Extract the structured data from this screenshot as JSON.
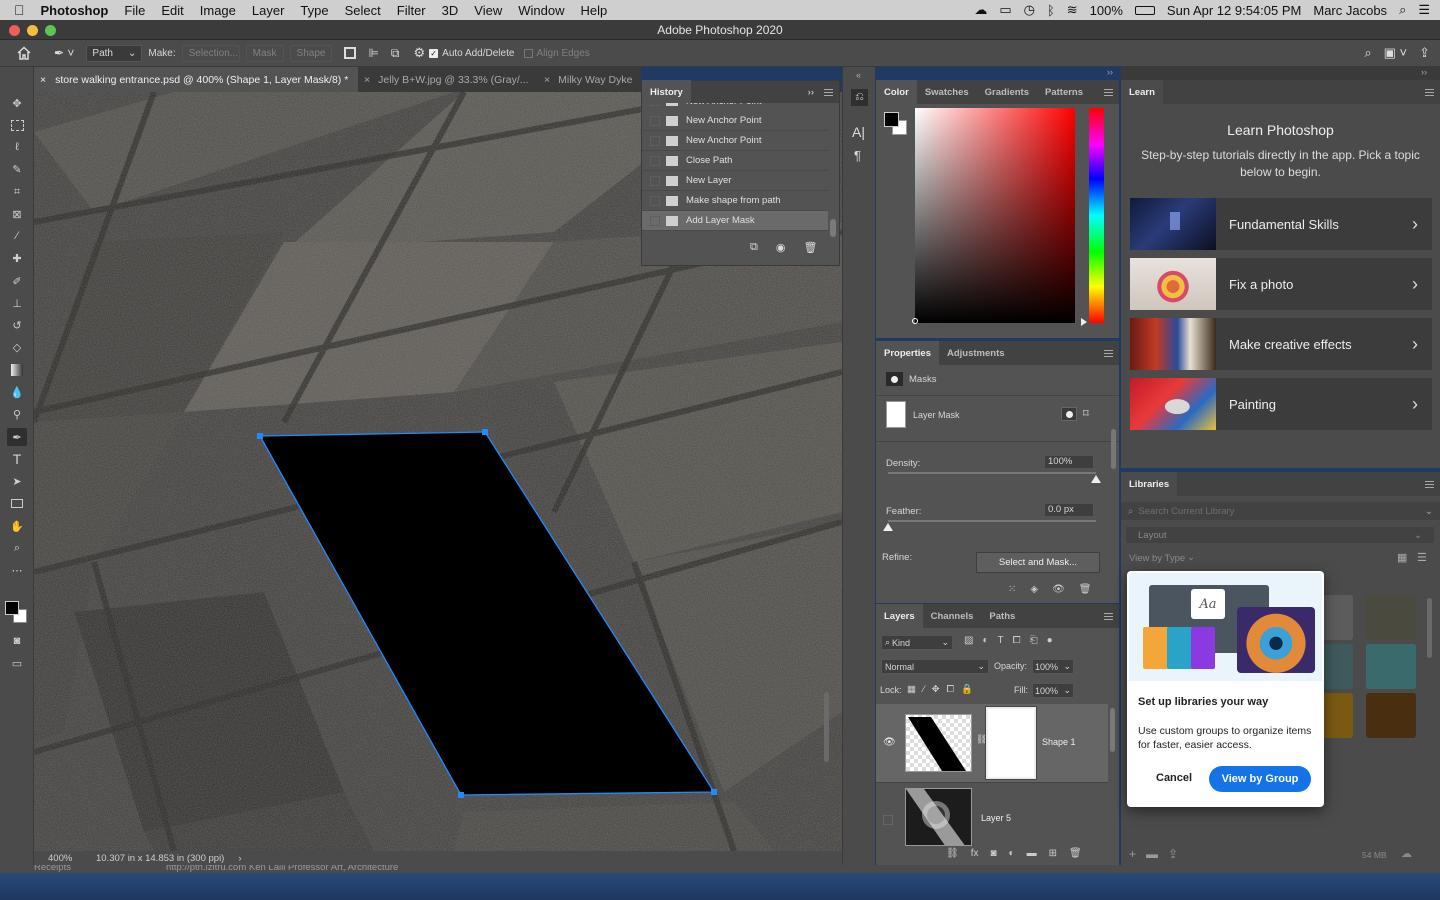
{
  "menubar": {
    "apple": "",
    "app": "Photoshop",
    "items": [
      "File",
      "Edit",
      "Image",
      "Layer",
      "Type",
      "Select",
      "Filter",
      "3D",
      "View",
      "Window",
      "Help"
    ],
    "battery": "100%",
    "datetime": "Sun Apr 12  9:54:05 PM",
    "user": "Marc Jacobs"
  },
  "titlebar": {
    "title": "Adobe Photoshop 2020"
  },
  "options": {
    "mode": "Path",
    "make_label": "Make:",
    "selection": "Selection...",
    "mask": "Mask",
    "shape": "Shape",
    "auto_add_delete": "Auto Add/Delete",
    "align_edges": "Align Edges"
  },
  "doctabs": [
    {
      "label": "store walking entrance.psd @ 400% (Shape 1, Layer Mask/8) *"
    },
    {
      "label": "Jelly B+W.jpg @ 33.3% (Gray/..."
    },
    {
      "label": "Milky Way Dyke"
    }
  ],
  "status": {
    "zoom": "400%",
    "size": "10.307 in x 14.853 in (300 ppi)"
  },
  "history": {
    "title": "History",
    "items": [
      "New Anchor Point",
      "New Anchor Point",
      "New Anchor Point",
      "Close Path",
      "New Layer",
      "Make shape from path",
      "Add Layer Mask"
    ]
  },
  "color_panel": {
    "tabs": [
      "Color",
      "Swatches",
      "Gradients",
      "Patterns"
    ]
  },
  "properties": {
    "tabs": [
      "Properties",
      "Adjustments"
    ],
    "masks_label": "Masks",
    "layer_mask": "Layer Mask",
    "density_label": "Density:",
    "density_value": "100%",
    "density_level": 1.0,
    "feather_label": "Feather:",
    "feather_value": "0.0 px",
    "feather_level": 0.0,
    "refine_label": "Refine:",
    "select_mask": "Select and Mask..."
  },
  "layers": {
    "tabs": [
      "Layers",
      "Channels",
      "Paths"
    ],
    "kind": "Kind",
    "blend": "Normal",
    "opacity_label": "Opacity:",
    "opacity": "100%",
    "lock_label": "Lock:",
    "fill_label": "Fill:",
    "fill": "100%",
    "items": [
      {
        "name": "Shape 1"
      },
      {
        "name": "Layer 5"
      }
    ]
  },
  "learn": {
    "tab": "Learn",
    "title": "Learn Photoshop",
    "subtitle": "Step-by-step tutorials directly in the app. Pick a topic below to begin.",
    "cards": [
      {
        "label": "Fundamental Skills"
      },
      {
        "label": "Fix a photo"
      },
      {
        "label": "Make creative effects"
      },
      {
        "label": "Painting"
      }
    ]
  },
  "libraries": {
    "tab": "Libraries",
    "search_placeholder": "Search Current Library",
    "layout": "Layout",
    "view_by": "View by Type",
    "storage": "54 MB",
    "swatches": [
      "#8a4a3e",
      "#8d7268",
      "#5c5c5c",
      "#4b4a3e",
      "#8a6a1c",
      "#5c3a14",
      "#3e5a5c",
      "#3a6a6c",
      "#6e5a12",
      "#7a6418",
      "#7a5a12",
      "#4a2e10",
      "#2e2e2e",
      "#5c4a10"
    ]
  },
  "popup": {
    "title": "Set up libraries your way",
    "body": "Use custom groups to organize items for faster, easier access.",
    "cancel": "Cancel",
    "confirm": "View by Group",
    "accent": "#1473e6"
  },
  "bottom": {
    "caption": "http://pth.izitru.com Ken Laili Professor Art, Architecture",
    "left": "Receipts"
  }
}
